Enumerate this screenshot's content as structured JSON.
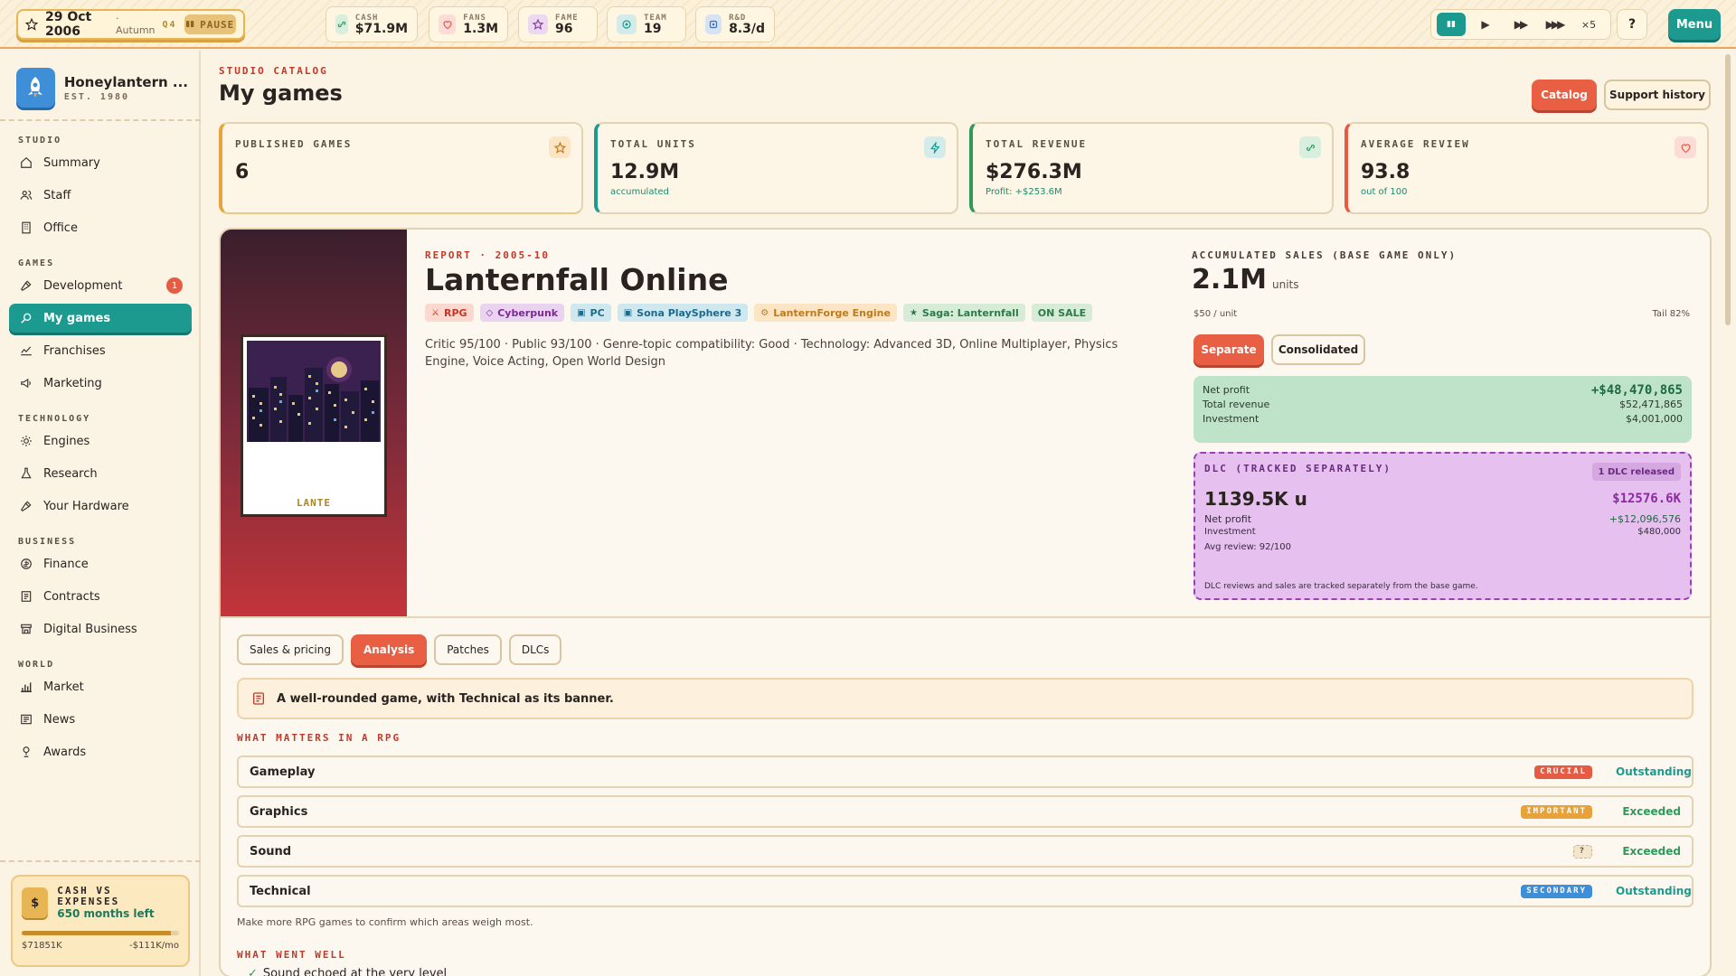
{
  "topbar": {
    "date": "29 Oct 2006",
    "season": "· Autumn",
    "quarter": "Q4",
    "pause_label": "PAUSE",
    "stats": [
      {
        "label": "CASH",
        "value": "$71.9M",
        "icon": "cash-icon"
      },
      {
        "label": "FANS",
        "value": "1.3M",
        "icon": "heart-icon"
      },
      {
        "label": "FAME",
        "value": "96",
        "icon": "star-icon"
      },
      {
        "label": "TEAM",
        "value": "19",
        "icon": "team-icon"
      },
      {
        "label": "R&D",
        "value": "8.3/d",
        "icon": "flask-icon"
      }
    ],
    "speed_multiplier": "×5",
    "help_label": "?",
    "menu_label": "Menu"
  },
  "sidebar": {
    "studio_name": "Honeylantern ...",
    "studio_est": "EST. 1980",
    "sections": [
      {
        "title": "STUDIO",
        "items": [
          {
            "label": "Summary",
            "icon": "home-icon"
          },
          {
            "label": "Staff",
            "icon": "people-icon"
          },
          {
            "label": "Office",
            "icon": "building-icon"
          }
        ]
      },
      {
        "title": "GAMES",
        "items": [
          {
            "label": "Development",
            "icon": "hammer-icon",
            "badge": "1"
          },
          {
            "label": "My games",
            "icon": "search-icon",
            "active": true
          },
          {
            "label": "Franchises",
            "icon": "chart-icon"
          },
          {
            "label": "Marketing",
            "icon": "megaphone-icon"
          }
        ]
      },
      {
        "title": "TECHNOLOGY",
        "items": [
          {
            "label": "Engines",
            "icon": "gear-icon"
          },
          {
            "label": "Research",
            "icon": "flask-icon"
          },
          {
            "label": "Your Hardware",
            "icon": "hammer-icon"
          }
        ]
      },
      {
        "title": "BUSINESS",
        "items": [
          {
            "label": "Finance",
            "icon": "coin-icon"
          },
          {
            "label": "Contracts",
            "icon": "document-icon"
          },
          {
            "label": "Digital Business",
            "icon": "store-icon"
          }
        ]
      },
      {
        "title": "WORLD",
        "items": [
          {
            "label": "Market",
            "icon": "bar-chart-icon"
          },
          {
            "label": "News",
            "icon": "newspaper-icon"
          },
          {
            "label": "Awards",
            "icon": "trophy-icon"
          }
        ]
      }
    ],
    "cash_card": {
      "title": "CASH VS EXPENSES",
      "subtitle": "650 months left",
      "left": "$71851K",
      "right": "-$111K/mo",
      "fill_fraction": 0.95
    }
  },
  "header": {
    "eyebrow": "STUDIO CATALOG",
    "title": "My games",
    "catalog_button": "Catalog",
    "support_button": "Support history"
  },
  "kpis": [
    {
      "label": "PUBLISHED GAMES",
      "value": "6",
      "sub": "",
      "accent": "#e8a23a",
      "icon": "star-icon"
    },
    {
      "label": "TOTAL UNITS",
      "value": "12.9M",
      "sub": "accumulated",
      "accent": "#1d9a90",
      "icon": "bolt-icon"
    },
    {
      "label": "TOTAL REVENUE",
      "value": "$276.3M",
      "sub": "Profit: +$253.6M",
      "accent": "#2e9a5a",
      "icon": "link-icon"
    },
    {
      "label": "AVERAGE REVIEW",
      "value": "93.8",
      "sub": "out of 100",
      "accent": "#e55b43",
      "icon": "heart-icon"
    }
  ],
  "game": {
    "cover_title": "LANTE",
    "report_eyebrow": "REPORT · 2005-10",
    "title": "Lanternfall Online",
    "tags": [
      {
        "label": "RPG",
        "icon": "sword-icon",
        "bg": "#fbd9cf",
        "fg": "#c0392b"
      },
      {
        "label": "Cyberpunk",
        "icon": "tag-icon",
        "bg": "#ead3f0",
        "fg": "#7a2a90"
      },
      {
        "label": "PC",
        "icon": "gamepad-icon",
        "bg": "#cfe7ef",
        "fg": "#1d6a8a"
      },
      {
        "label": "Sona PlaySphere 3",
        "icon": "gamepad-icon",
        "bg": "#cfe7ef",
        "fg": "#1d6a8a"
      },
      {
        "label": "LanternForge Engine",
        "icon": "gear-icon",
        "bg": "#fbe5c4",
        "fg": "#c07a1a"
      },
      {
        "label": "Saga: Lanternfall",
        "icon": "star-icon",
        "bg": "#d6ecd6",
        "fg": "#2e7a4a"
      },
      {
        "label": "ON SALE",
        "icon": "",
        "bg": "#d6ecd6",
        "fg": "#2e7a4a"
      }
    ],
    "description": "Critic 95/100 · Public 93/100 · Genre-topic compatibility: Good · Technology: Advanced 3D, Online Multiplayer, Physics Engine, Voice Acting, Open World Design",
    "sales": {
      "label": "ACCUMULATED SALES (BASE GAME ONLY)",
      "value": "2.1M",
      "unit": "units",
      "per_unit": "$50 / unit",
      "tail": "Tail 82%",
      "separate_label": "Separate",
      "consolidated_label": "Consolidated"
    },
    "profit": {
      "net_label": "Net profit",
      "net_value": "+$48,470,865",
      "revenue_label": "Total revenue",
      "revenue_value": "$52,471,865",
      "investment_label": "Investment",
      "investment_value": "$4,001,000"
    },
    "dlc": {
      "label": "DLC (TRACKED SEPARATELY)",
      "badge": "1 DLC released",
      "units": "1139.5K u",
      "money": "$12576.6K",
      "net_label": "Net profit",
      "net_value": "+$12,096,576",
      "investment_label": "Investment",
      "investment_value": "$480,000",
      "avg_review": "Avg review: 92/100",
      "note": "DLC reviews and sales are tracked separately from the base game."
    },
    "tabs": [
      {
        "label": "Sales & pricing"
      },
      {
        "label": "Analysis",
        "active": true
      },
      {
        "label": "Patches"
      },
      {
        "label": "DLCs"
      }
    ],
    "analysis": {
      "banner": "A well-rounded game, with Technical as its banner.",
      "what_matters_label": "WHAT MATTERS IN A RPG",
      "factors": [
        {
          "name": "Gameplay",
          "weight": "CRUCIAL",
          "weight_color": "#e55b43",
          "status": "Outstanding"
        },
        {
          "name": "Graphics",
          "weight": "IMPORTANT",
          "weight_color": "#e8a23a",
          "status": "Exceeded"
        },
        {
          "name": "Sound",
          "weight": "?",
          "weight_color": "#f3e6cc",
          "status": "Exceeded"
        },
        {
          "name": "Technical",
          "weight": "SECONDARY",
          "weight_color": "#3f8fd8",
          "status": "Outstanding"
        }
      ],
      "note": "Make more RPG games to confirm which areas weigh most.",
      "what_went_well_label": "WHAT WENT WELL",
      "went_well_first": "Sound echoed at the very level"
    }
  }
}
